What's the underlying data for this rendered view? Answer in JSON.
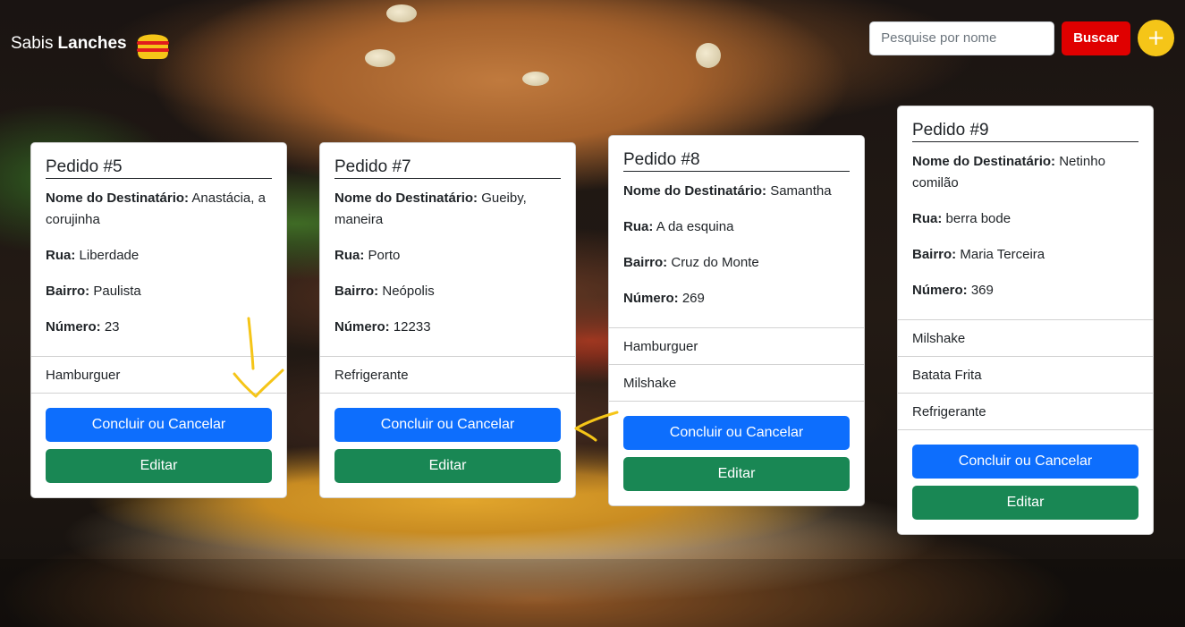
{
  "header": {
    "brand_light": "Sabis",
    "brand_bold": "Lanches",
    "search_placeholder": "Pesquise por nome",
    "search_button": "Buscar",
    "add_button": "+"
  },
  "labels": {
    "recipient": "Nome do Destinatário:",
    "street": "Rua:",
    "district": "Bairro:",
    "number": "Número:",
    "complete_button": "Concluir ou Cancelar",
    "edit_button": "Editar"
  },
  "orders": [
    {
      "title": "Pedido #5",
      "recipient": "Anastácia, a corujinha",
      "street": "Liberdade",
      "district": "Paulista",
      "number": "23",
      "items": [
        "Hamburguer"
      ]
    },
    {
      "title": "Pedido #7",
      "recipient": "Gueiby, maneira",
      "street": "Porto",
      "district": "Neópolis",
      "number": "12233",
      "items": [
        "Refrigerante"
      ]
    },
    {
      "title": "Pedido #8",
      "recipient": "Samantha",
      "street": "A da esquina",
      "district": "Cruz do Monte",
      "number": "269",
      "items": [
        "Hamburguer",
        "Milshake"
      ]
    },
    {
      "title": "Pedido #9",
      "recipient": "Netinho comilão",
      "street": "berra bode",
      "district": "Maria Terceira",
      "number": "369",
      "items": [
        "Milshake",
        "Batata Frita",
        "Refrigerante"
      ]
    }
  ],
  "colors": {
    "search_button": "#e00000",
    "add_button": "#f5c518",
    "complete_button": "#0d6efd",
    "edit_button": "#198754",
    "annotation": "#f5c518"
  }
}
